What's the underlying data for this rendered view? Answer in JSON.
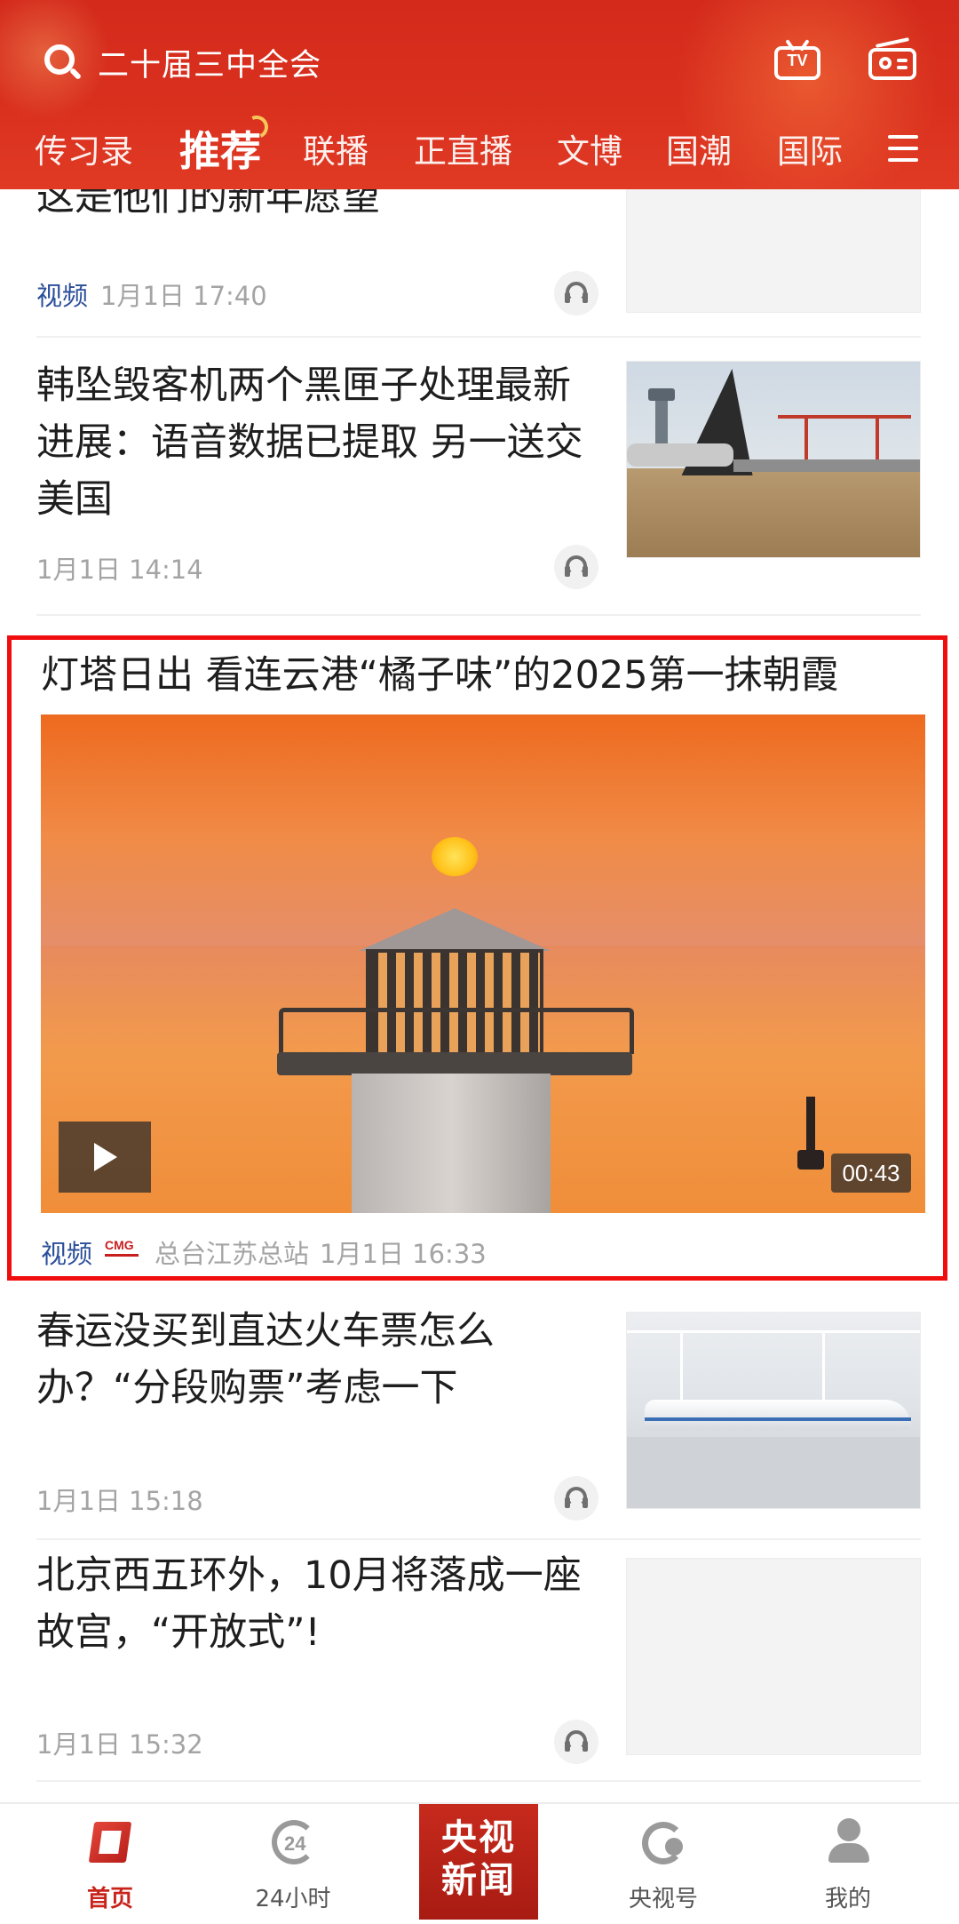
{
  "header": {
    "search_text": "二十届三中全会",
    "tv_label": "TV",
    "tabs": [
      {
        "label": "传习录",
        "active": false
      },
      {
        "label": "推荐",
        "active": true
      },
      {
        "label": "联播",
        "active": false
      },
      {
        "label": "正直播",
        "active": false
      },
      {
        "label": "文博",
        "active": false
      },
      {
        "label": "国潮",
        "active": false
      },
      {
        "label": "国际",
        "active": false
      }
    ],
    "accent_color": "#d42a1c"
  },
  "feed": {
    "items": [
      {
        "title": "这是他们的新年愿望",
        "tag": "视频",
        "time": "1月1日 17:40"
      },
      {
        "title": "韩坠毁客机两个黑匣子处理最新进展：语音数据已提取 另一送交美国",
        "time": "1月1日 14:14"
      },
      {
        "title": "灯塔日出 看连云港“橘子味”的2025第一抹朝霞",
        "tag": "视频",
        "source_logo": "CMG",
        "source": "总台江苏总站",
        "time": "1月1日 16:33",
        "duration": "00:43",
        "highlighted": true
      },
      {
        "title": "春运没买到直达火车票怎么办？“分段购票”考虑一下",
        "time": "1月1日 15:18"
      },
      {
        "title": "北京西五环外，10月将落成一座故宫，“开放式”!",
        "time": "1月1日 15:32"
      }
    ]
  },
  "bottom_nav": {
    "items": [
      {
        "label": "首页",
        "icon": "home-icon",
        "active": true
      },
      {
        "label": "24小时",
        "icon": "24h-icon",
        "active": false
      },
      {
        "label": "央视新闻",
        "icon": "cctv-news-logo",
        "active": false
      },
      {
        "label": "央视号",
        "icon": "cctv-hao-icon",
        "active": false
      },
      {
        "label": "我的",
        "icon": "profile-icon",
        "active": false
      }
    ],
    "center_logo_line1": "央视",
    "center_logo_line2": "新闻",
    "active_color": "#c8241b"
  }
}
